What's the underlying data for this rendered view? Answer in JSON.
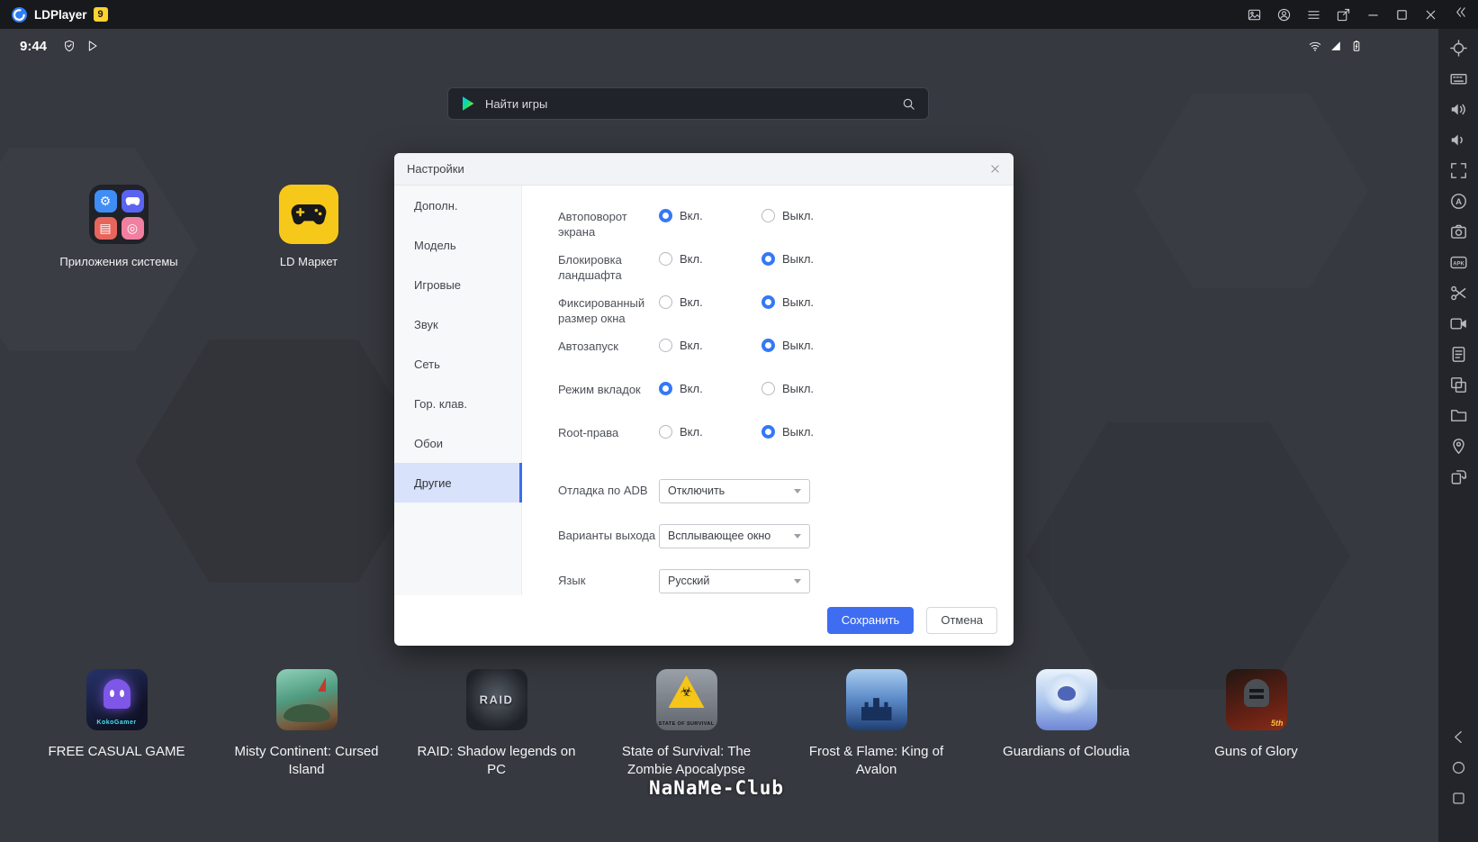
{
  "titlebar": {
    "app_name": "LDPlayer",
    "version_badge": "9",
    "right_icons": [
      "wallpaper",
      "account",
      "menu",
      "popout"
    ],
    "window_controls": [
      "minimize",
      "maximize",
      "close"
    ],
    "collapse_icon": "collapse"
  },
  "statusbar": {
    "time": "9:44",
    "left_icons": [
      "shield",
      "play-store"
    ],
    "right_icons": [
      "wifi",
      "signal",
      "battery"
    ]
  },
  "search": {
    "placeholder": "Найти игры"
  },
  "desktop": {
    "folder": {
      "label": "Приложения системы",
      "mini_apps": [
        "settings",
        "games",
        "files",
        "camera"
      ]
    },
    "market": {
      "label": "LD Маркет"
    }
  },
  "dialog": {
    "title": "Настройки",
    "tabs": [
      {
        "label": "Дополн.",
        "selected": false
      },
      {
        "label": "Модель",
        "selected": false
      },
      {
        "label": "Игровые",
        "selected": false
      },
      {
        "label": "Звук",
        "selected": false
      },
      {
        "label": "Сеть",
        "selected": false
      },
      {
        "label": "Гор. клав.",
        "selected": false
      },
      {
        "label": "Обои",
        "selected": false
      },
      {
        "label": "Другие",
        "selected": true
      }
    ],
    "radio_settings": [
      {
        "label": "Автоповорот экрана",
        "on_label": "Вкл.",
        "off_label": "Выкл.",
        "value": "on"
      },
      {
        "label": "Блокировка ландшафта",
        "on_label": "Вкл.",
        "off_label": "Выкл.",
        "value": "off"
      },
      {
        "label": "Фиксированный размер окна",
        "on_label": "Вкл.",
        "off_label": "Выкл.",
        "value": "off"
      },
      {
        "label": "Автозапуск",
        "on_label": "Вкл.",
        "off_label": "Выкл.",
        "value": "off"
      },
      {
        "label": "Режим вкладок",
        "on_label": "Вкл.",
        "off_label": "Выкл.",
        "value": "on"
      },
      {
        "label": "Root-права",
        "on_label": "Вкл.",
        "off_label": "Выкл.",
        "value": "off"
      }
    ],
    "dropdown_settings": [
      {
        "label": "Отладка по ADB",
        "value": "Отключить"
      },
      {
        "label": "Варианты выхода",
        "value": "Всплывающее окно"
      },
      {
        "label": "Язык",
        "value": "Русский"
      }
    ],
    "buttons": {
      "save": "Сохранить",
      "cancel": "Отмена"
    }
  },
  "dock": [
    {
      "label": "FREE CASUAL GAME",
      "tile_text": "KokoGamer",
      "style": "kokogamer"
    },
    {
      "label": "Misty Continent: Cursed Island",
      "tile_text": "",
      "style": "misty"
    },
    {
      "label": "RAID: Shadow legends on PC",
      "tile_text": "RAID",
      "style": "raid"
    },
    {
      "label": "State of Survival: The Zombie Apocalypse",
      "tile_text": "STATE OF SURVIVAL",
      "style": "sos"
    },
    {
      "label": "Frost & Flame: King of Avalon",
      "tile_text": "",
      "style": "frost"
    },
    {
      "label": "Guardians of Cloudia",
      "tile_text": "",
      "style": "cloudia"
    },
    {
      "label": "Guns of Glory",
      "tile_text": "5th",
      "style": "guns"
    }
  ],
  "side_toolbar": {
    "top_icons": [
      "locate",
      "keyboard",
      "volume-up",
      "volume-down",
      "fullscreen",
      "virtual-key",
      "screenshot",
      "apk",
      "scissors",
      "video",
      "script",
      "multi-window",
      "folder",
      "location",
      "rotate"
    ],
    "bottom_icons": [
      "back",
      "home",
      "recents"
    ]
  },
  "watermark": "NaNaMe-Club",
  "colors": {
    "accent_blue": "#3a6df0",
    "radio_blue": "#3478f6",
    "badge_yellow": "#ffd22e",
    "selected_tab_bg": "#d9e2fb",
    "market_yellow": "#f6c81a"
  }
}
